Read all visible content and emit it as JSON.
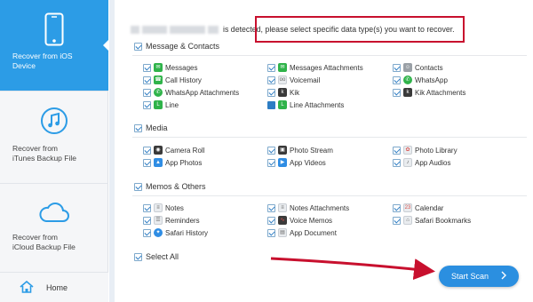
{
  "sidebar": {
    "items": [
      {
        "label_line1": "Recover from iOS",
        "label_line2": "Device",
        "icon": "iphone-icon"
      },
      {
        "label_line1": "Recover from",
        "label_line2": "iTunes Backup File",
        "icon": "music-note-icon"
      },
      {
        "label_line1": "Recover from",
        "label_line2": "iCloud Backup File",
        "icon": "cloud-icon"
      }
    ],
    "home_label": "Home"
  },
  "header": {
    "detected_text": "is detected, please select specific data type(s) you want to recover."
  },
  "sections": {
    "messages": {
      "title": "Message & Contacts",
      "items": [
        "Messages",
        "Messages Attachments",
        "Contacts",
        "Call History",
        "Voicemail",
        "WhatsApp",
        "WhatsApp Attachments",
        "Kik",
        "Kik Attachments",
        "Line",
        "Line Attachments"
      ]
    },
    "media": {
      "title": "Media",
      "items": [
        "Camera Roll",
        "Photo Stream",
        "Photo Library",
        "App Photos",
        "App Videos",
        "App Audios"
      ]
    },
    "memos": {
      "title": "Memos & Others",
      "items": [
        "Notes",
        "Notes Attachments",
        "Calendar",
        "Reminders",
        "Voice Memos",
        "Safari Bookmarks",
        "Safari History",
        "App Document"
      ]
    }
  },
  "select_all_label": "Select All",
  "start_scan_label": "Start Scan",
  "colors": {
    "accent": "#2c9ce6",
    "highlight_box": "#c8102e",
    "arrow": "#c8102e"
  }
}
